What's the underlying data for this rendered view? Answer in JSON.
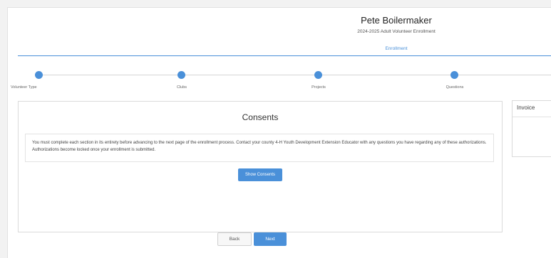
{
  "header": {
    "user_name": "Pete Boilermaker",
    "subtitle": "2024-2025 Adult Volunteer Enrollment",
    "section_link": "Enrollment"
  },
  "steps": [
    {
      "label": "Volunteer Type"
    },
    {
      "label": "Clubs"
    },
    {
      "label": "Projects"
    },
    {
      "label": "Questions"
    }
  ],
  "consents": {
    "title": "Consents",
    "notice": "You must complete each section in its entirety before advancing to the next page of the enrollment process. Contact your county 4-H Youth Development Extension Educator with any questions you have regarding any of these authorizations. Authorizations become locked once your enrollment is submitted.",
    "show_button": "Show Consents"
  },
  "invoice": {
    "title": "Invoice"
  },
  "nav": {
    "back_label": "Back",
    "next_label": "Next"
  },
  "colors": {
    "accent": "#4a90d9",
    "background": "#f2f2f2"
  }
}
